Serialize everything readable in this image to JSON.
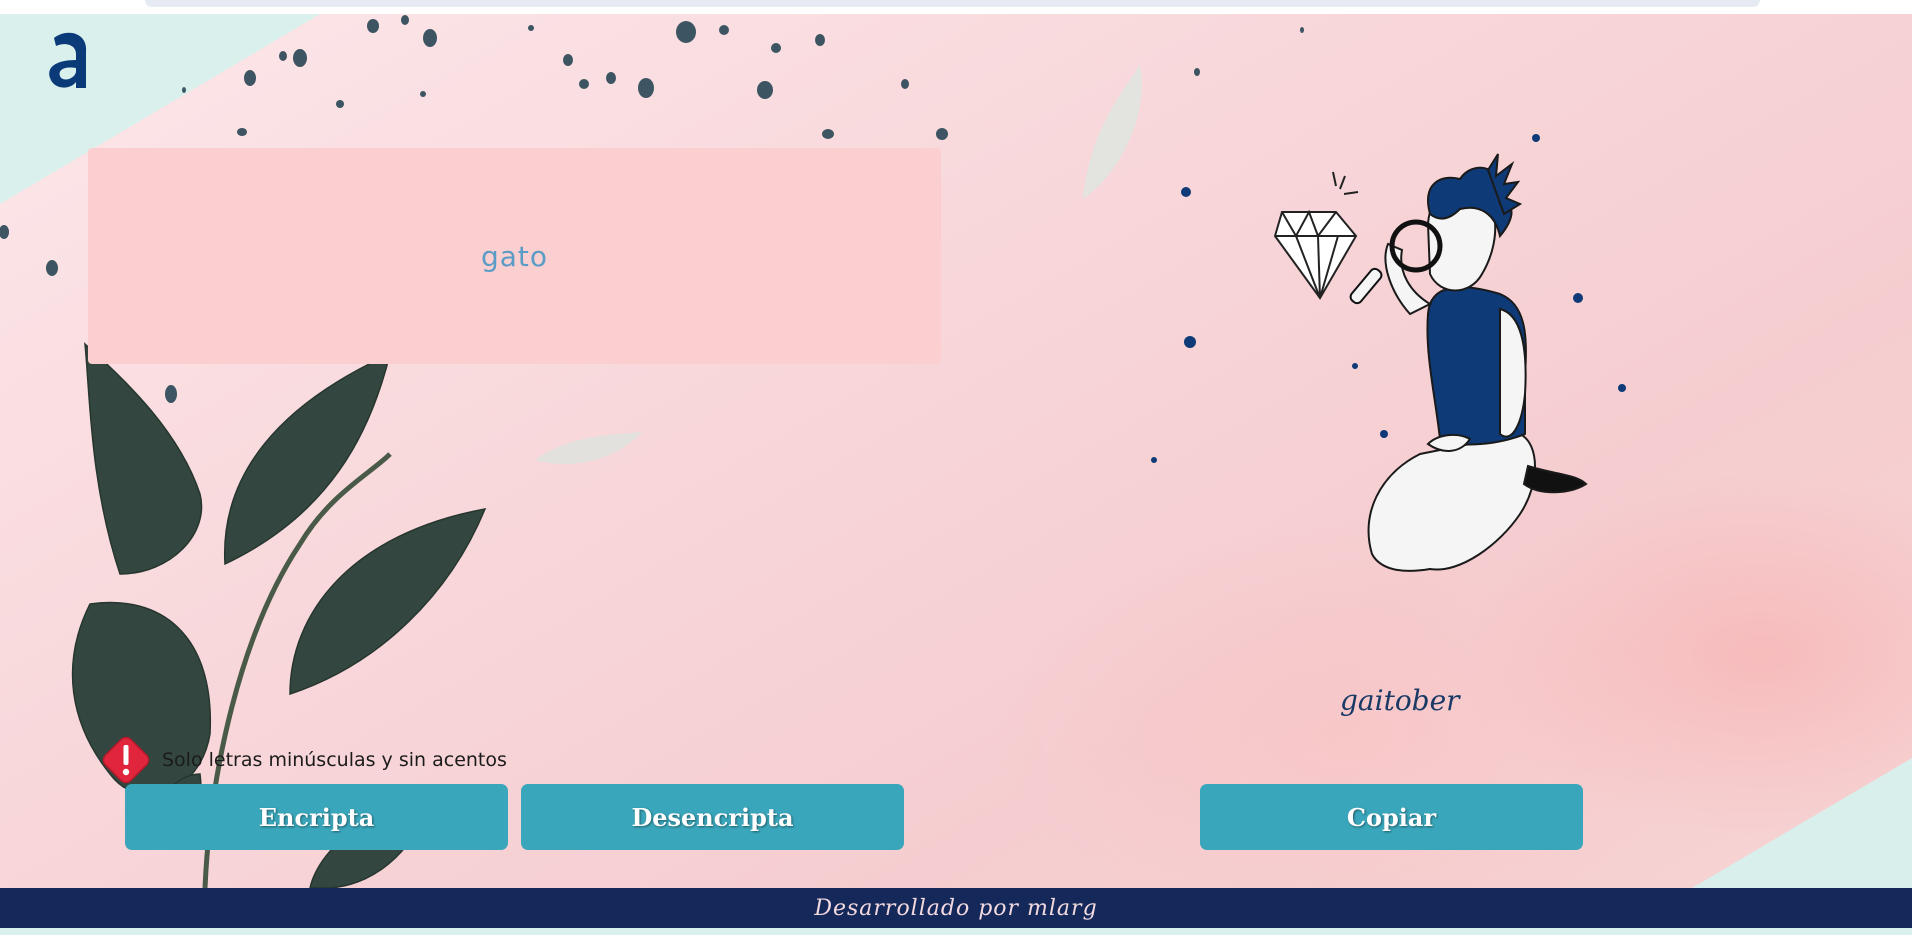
{
  "logo": {
    "letter": "a"
  },
  "input": {
    "value": "gato"
  },
  "warning": {
    "icon": "exclamation-icon",
    "text": "Solo letras minúsculas y sin acentos"
  },
  "buttons": {
    "encrypt": "Encripta",
    "decrypt": "Desencripta",
    "copy": "Copiar"
  },
  "output": {
    "result": "gaitober"
  },
  "footer": {
    "text": "Desarrollado por mlarg"
  },
  "colors": {
    "accent": "#3aa6bb",
    "footer_bg": "#14295a",
    "input_bg": "#fbcfcf",
    "warning": "#e0253c",
    "logo": "#0b3a78"
  }
}
